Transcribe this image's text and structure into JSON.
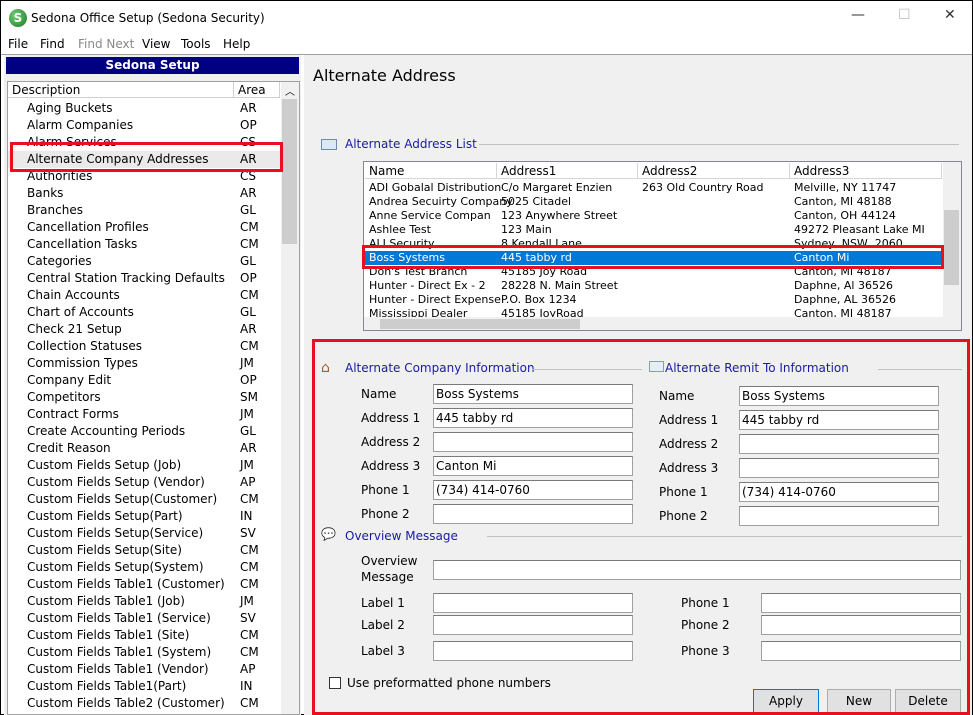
{
  "window": {
    "title": "Sedona Office Setup (Sedona Security)",
    "minimize": "—",
    "maximize": "☐",
    "close": "✕"
  },
  "menu": [
    "File",
    "Find",
    "Find Next",
    "View",
    "Tools",
    "Help"
  ],
  "sidebar": {
    "header": "Sedona Setup",
    "col_description": "Description",
    "col_area": "Area",
    "selected": "Alternate Company Addresses",
    "items": [
      {
        "d": "Aging Buckets",
        "a": "AR"
      },
      {
        "d": "Alarm Companies",
        "a": "OP"
      },
      {
        "d": "Alarm Services",
        "a": "CS"
      },
      {
        "d": "Alternate Company Addresses",
        "a": "AR"
      },
      {
        "d": "Authorities",
        "a": "CS"
      },
      {
        "d": "Banks",
        "a": "AR"
      },
      {
        "d": "Branches",
        "a": "GL"
      },
      {
        "d": "Cancellation Profiles",
        "a": "CM"
      },
      {
        "d": "Cancellation Tasks",
        "a": "CM"
      },
      {
        "d": "Categories",
        "a": "GL"
      },
      {
        "d": "Central Station Tracking Defaults",
        "a": "OP"
      },
      {
        "d": "Chain Accounts",
        "a": "CM"
      },
      {
        "d": "Chart of Accounts",
        "a": "GL"
      },
      {
        "d": "Check 21 Setup",
        "a": "AR"
      },
      {
        "d": "Collection Statuses",
        "a": "CM"
      },
      {
        "d": "Commission Types",
        "a": "JM"
      },
      {
        "d": "Company Edit",
        "a": "OP"
      },
      {
        "d": "Competitors",
        "a": "SM"
      },
      {
        "d": "Contract Forms",
        "a": "JM"
      },
      {
        "d": "Create Accounting Periods",
        "a": "GL"
      },
      {
        "d": "Credit Reason",
        "a": "AR"
      },
      {
        "d": "Custom Fields Setup (Job)",
        "a": "JM"
      },
      {
        "d": "Custom Fields Setup (Vendor)",
        "a": "AP"
      },
      {
        "d": "Custom Fields Setup(Customer)",
        "a": "CM"
      },
      {
        "d": "Custom Fields Setup(Part)",
        "a": "IN"
      },
      {
        "d": "Custom Fields Setup(Service)",
        "a": "SV"
      },
      {
        "d": "Custom Fields Setup(Site)",
        "a": "CM"
      },
      {
        "d": "Custom Fields Setup(System)",
        "a": "CM"
      },
      {
        "d": "Custom Fields Table1 (Customer)",
        "a": "CM"
      },
      {
        "d": "Custom Fields Table1 (Job)",
        "a": "JM"
      },
      {
        "d": "Custom Fields Table1 (Service)",
        "a": "SV"
      },
      {
        "d": "Custom Fields Table1 (Site)",
        "a": "CM"
      },
      {
        "d": "Custom Fields Table1 (System)",
        "a": "CM"
      },
      {
        "d": "Custom Fields Table1 (Vendor)",
        "a": "AP"
      },
      {
        "d": "Custom Fields Table1(Part)",
        "a": "IN"
      },
      {
        "d": "Custom Fields Table2 (Customer)",
        "a": "CM"
      }
    ]
  },
  "main": {
    "title": "Alternate Address",
    "list_title": "Alternate Address List",
    "columns": [
      "Name",
      "Address1",
      "Address2",
      "Address3"
    ],
    "rows": [
      [
        "ADI Gobalal Distribution",
        "C/o Margaret Enzien",
        "263 Old Country Road",
        "Melville, NY 11747"
      ],
      [
        "Andrea Secuirty Company",
        "5025 Citadel",
        "",
        "Canton, MI 48188"
      ],
      [
        "Anne Service Compan",
        "123 Anywhere Street",
        "",
        "Canton, OH  44124"
      ],
      [
        "Ashlee Test",
        "123 Main",
        "",
        "49272 Pleasant Lake MI"
      ],
      [
        "ALI Security",
        "8 Kendall Lane",
        "",
        "Sydney, NSW, 2060"
      ],
      [
        "Boss Systems",
        "445 tabby rd",
        "",
        "Canton Mi"
      ],
      [
        "Don's Test Branch",
        "45185 Joy Road",
        "",
        "Canton, MI  48187"
      ],
      [
        "Hunter - Direct Ex - 2",
        "28228 N. Main Street",
        "",
        "Daphne, Al 36526"
      ],
      [
        "Hunter - Direct Expense",
        "P.O. Box 1234",
        "",
        "Daphne, AL  36526"
      ],
      [
        "Mississippi Dealer",
        "45185 JoyRoad",
        "",
        "Canton, MI  48187"
      ]
    ],
    "selected_row": 5,
    "company": {
      "title": "Alternate Company Information",
      "labels": [
        "Name",
        "Address 1",
        "Address 2",
        "Address 3",
        "Phone 1",
        "Phone 2"
      ],
      "values": [
        "Boss Systems",
        "445 tabby rd",
        "",
        "Canton Mi",
        "(734) 414-0760",
        ""
      ]
    },
    "remit": {
      "title": "Alternate Remit To Information",
      "labels": [
        "Name",
        "Address 1",
        "Address 2",
        "Address 3",
        "Phone 1",
        "Phone 2"
      ],
      "values": [
        "Boss Systems",
        "445 tabby rd",
        "",
        "",
        "(734) 414-0760",
        ""
      ]
    },
    "overview": {
      "title": "Overview Message",
      "message_label_1": "Overview",
      "message_label_2": "Message",
      "message": "",
      "labels": [
        "Label 1",
        "Label 2",
        "Label 3"
      ],
      "phones": [
        "Phone 1",
        "Phone 2",
        "Phone 3"
      ]
    },
    "checkbox": {
      "label": "Use preformatted phone numbers",
      "checked": false
    },
    "buttons": {
      "apply": "Apply",
      "new": "New",
      "delete": "Delete"
    }
  },
  "colors": {
    "accent": "#000080",
    "selection": "#0078d7",
    "highlight_box": "#e8101e",
    "section_text": "#1a1aa6"
  }
}
